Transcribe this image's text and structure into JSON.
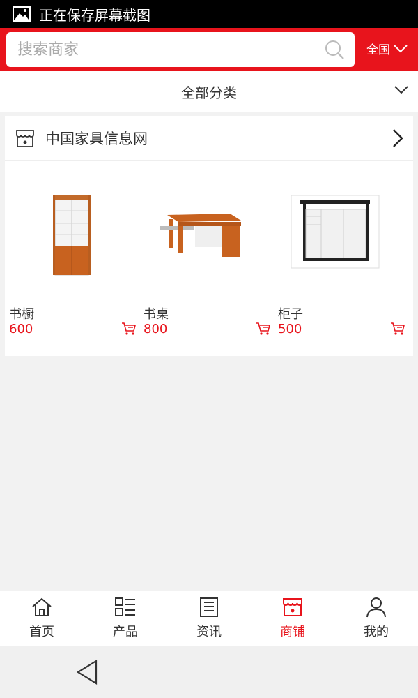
{
  "status": {
    "text": "正在保存屏幕截图"
  },
  "search": {
    "placeholder": "搜索商家",
    "region": "全国"
  },
  "category": {
    "label": "全部分类"
  },
  "shop": {
    "name": "中国家具信息网",
    "products": [
      {
        "name": "书橱",
        "price": "600"
      },
      {
        "name": "书桌",
        "price": "800"
      },
      {
        "name": "柜子",
        "price": "500"
      }
    ]
  },
  "tabs": [
    {
      "label": "首页",
      "icon": "home-icon"
    },
    {
      "label": "产品",
      "icon": "list-icon"
    },
    {
      "label": "资讯",
      "icon": "news-icon"
    },
    {
      "label": "商铺",
      "icon": "shop-icon",
      "active": true
    },
    {
      "label": "我的",
      "icon": "user-icon"
    }
  ],
  "colors": {
    "accent": "#e8141c",
    "status_bar": "#000000"
  }
}
